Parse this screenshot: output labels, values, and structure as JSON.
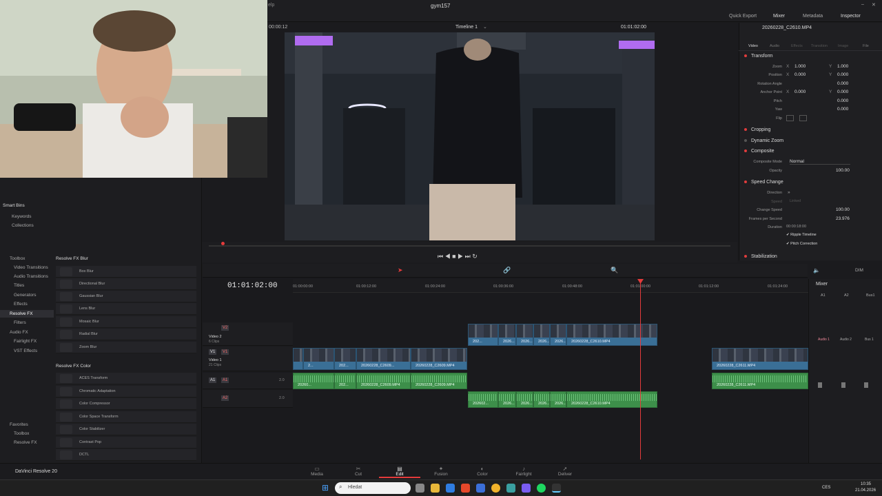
{
  "window": {
    "project_name": "gym157",
    "menu_stub": "elp",
    "header_tabs": [
      "Quick Export",
      "Mixer",
      "Metadata",
      "Inspector"
    ]
  },
  "viewer": {
    "source_timecode": "00:00:12",
    "timeline_name": "Timeline 1",
    "timeline_timecode": "01:01:02:00"
  },
  "inspector": {
    "clip_name": "20260228_C2610.MP4",
    "tabs": [
      "Video",
      "Audio",
      "Effects",
      "Transition",
      "Image",
      "File"
    ],
    "transform": {
      "title": "Transform",
      "zoom_label": "Zoom",
      "zoom_x": "1.000",
      "zoom_y": "1.000",
      "position_label": "Position",
      "pos_x": "0.000",
      "pos_y": "0.000",
      "rotation_label": "Rotation Angle",
      "rotation": "0.000",
      "anchor_label": "Anchor Point",
      "anchor_x": "0.000",
      "anchor_y": "0.000",
      "pitch_label": "Pitch",
      "pitch": "0.000",
      "yaw_label": "Yaw",
      "yaw": "0.000",
      "flip_label": "Flip",
      "x_label": "X",
      "y_label": "Y"
    },
    "sections": [
      "Cropping",
      "Dynamic Zoom",
      "Composite",
      "Speed Change",
      "Stabilization"
    ],
    "composite": {
      "mode_label": "Composite Mode",
      "mode": "Normal",
      "opacity_label": "Opacity",
      "opacity": "100.00"
    },
    "speed": {
      "direction_label": "Direction",
      "speed_label": "Speed",
      "speed_value": "Linked",
      "change_label": "Change Speed",
      "change": "100.00",
      "fps_label": "Frames per Second",
      "fps": "23.976",
      "duration_label": "Duration",
      "duration": "00:00:18:00",
      "ripple": "Ripple Timeline",
      "pitch_corr": "Pitch Correction"
    }
  },
  "left_panel": {
    "smart_bins_title": "Smart Bins",
    "smart_bins": [
      "Keywords",
      "Collections"
    ],
    "toolbox_tree": [
      "Toolbox",
      "Video Transitions",
      "Audio Transitions",
      "Titles",
      "Generators",
      "Effects",
      "Resolve FX",
      "Filters",
      "Audio FX",
      "Fairlight FX",
      "VST Effects"
    ],
    "fx_group1_title": "Resolve FX Blur",
    "fx_group1": [
      "Box Blur",
      "Directional Blur",
      "Gaussian Blur",
      "Lens Blur",
      "Mosaic Blur",
      "Radial Blur",
      "Zoom Blur"
    ],
    "fx_group2_title": "Resolve FX Color",
    "fx_group2": [
      "ACES Transform",
      "Chromatic Adaptation",
      "Color Compressor",
      "Color Space Transform",
      "Color Stabilizer",
      "Contrast Pop",
      "DCTL"
    ],
    "favorites_title": "Favorites",
    "favorites": [
      "Toolbox",
      "Resolve FX"
    ]
  },
  "timeline": {
    "current_tc": "01:01:02:00",
    "ruler_marks": [
      "01:00:00:00",
      "01:00:12:00",
      "01:00:24:00",
      "01:00:36:00",
      "01:00:48:00",
      "01:01:00:00",
      "01:01:12:00",
      "01:01:24:00"
    ],
    "tracks": {
      "v2": {
        "id": "V2",
        "name": "Video 2",
        "clips": "6 Clips"
      },
      "v1": {
        "src": "V1",
        "id": "V1",
        "name": "Video 1",
        "clips": "21 Clips"
      },
      "a1": {
        "src": "A1",
        "id": "A1",
        "level": "2.0"
      },
      "a2": {
        "id": "A2",
        "level": "2.0"
      }
    },
    "clip_labels": {
      "v2_short1": "202...",
      "v2_short2": "2026...",
      "v2_main": "20260228_C2610.MP4",
      "v1_a": "2...",
      "v1_b": "202...",
      "v1_c": "20260228_C2609...",
      "v1_d": "20260228_C2609.MP4",
      "v1_end": "20260228_C2611.MP4",
      "a1_a": "20260...",
      "a1_b": "202...",
      "a1_c": "20260228_C2609.MP4",
      "a1_d": "20260228_C2609.MP4",
      "a1_end": "20260228_C2611.MP4",
      "a2_a": "202602...",
      "a2_b": "2026...",
      "a2_main": "20260228_C2610.MP4"
    }
  },
  "mixer": {
    "title": "Mixer",
    "channels": [
      "A1",
      "A2",
      "Bus1"
    ],
    "strips": [
      "Audio 1",
      "Audio 2",
      "Bus 1"
    ],
    "dim": "DIM"
  },
  "pages": [
    "Media",
    "Cut",
    "Edit",
    "Fusion",
    "Color",
    "Fairlight",
    "Deliver"
  ],
  "app_name": "DaVinci Resolve 20",
  "taskbar": {
    "search_placeholder": "Hledat",
    "lang": "CES",
    "time": "10:35",
    "date": "21.04.2026"
  }
}
